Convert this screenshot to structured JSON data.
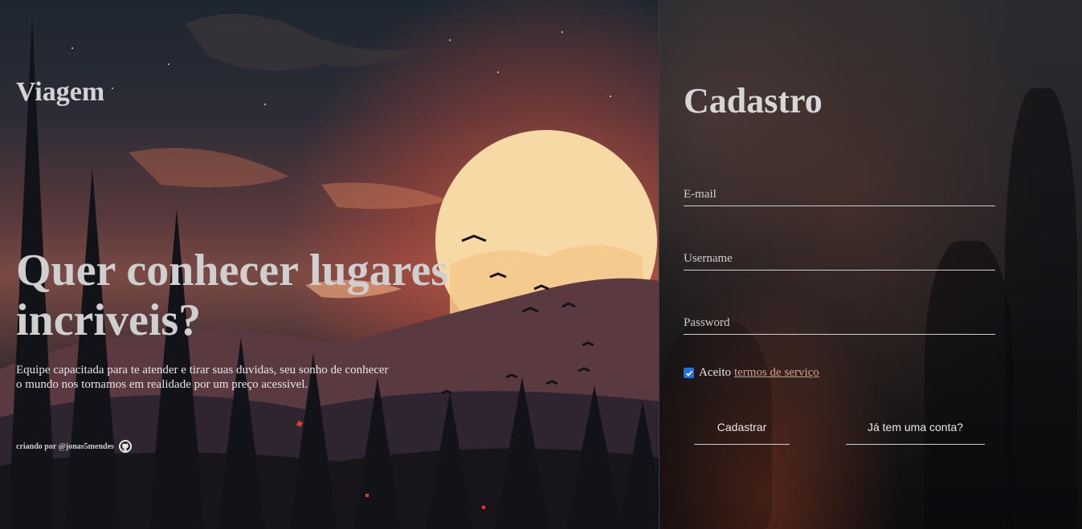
{
  "hero": {
    "brand": "Viagem",
    "headline": "Quer conhecer lugares incriveis?",
    "subtext": "Equipe capacitada para te atender e tirar suas duvidas, seu sonho de conhecer o mundo nos tornamos em realidade por um preço acessivel.",
    "credit": "criando por @jonas5mendes",
    "credit_icon": "github-icon"
  },
  "form": {
    "title": "Cadastro",
    "email_placeholder": "E-mail",
    "username_placeholder": "Username",
    "password_placeholder": "Password",
    "accept_label": "Aceito",
    "terms_link": "termos de serviço",
    "accept_checked": true,
    "register_button": "Cadastrar",
    "login_button": "Já tem uma conta?"
  },
  "colors": {
    "checkbox": "#1a73e8",
    "terms_link": "#d89a8a"
  }
}
